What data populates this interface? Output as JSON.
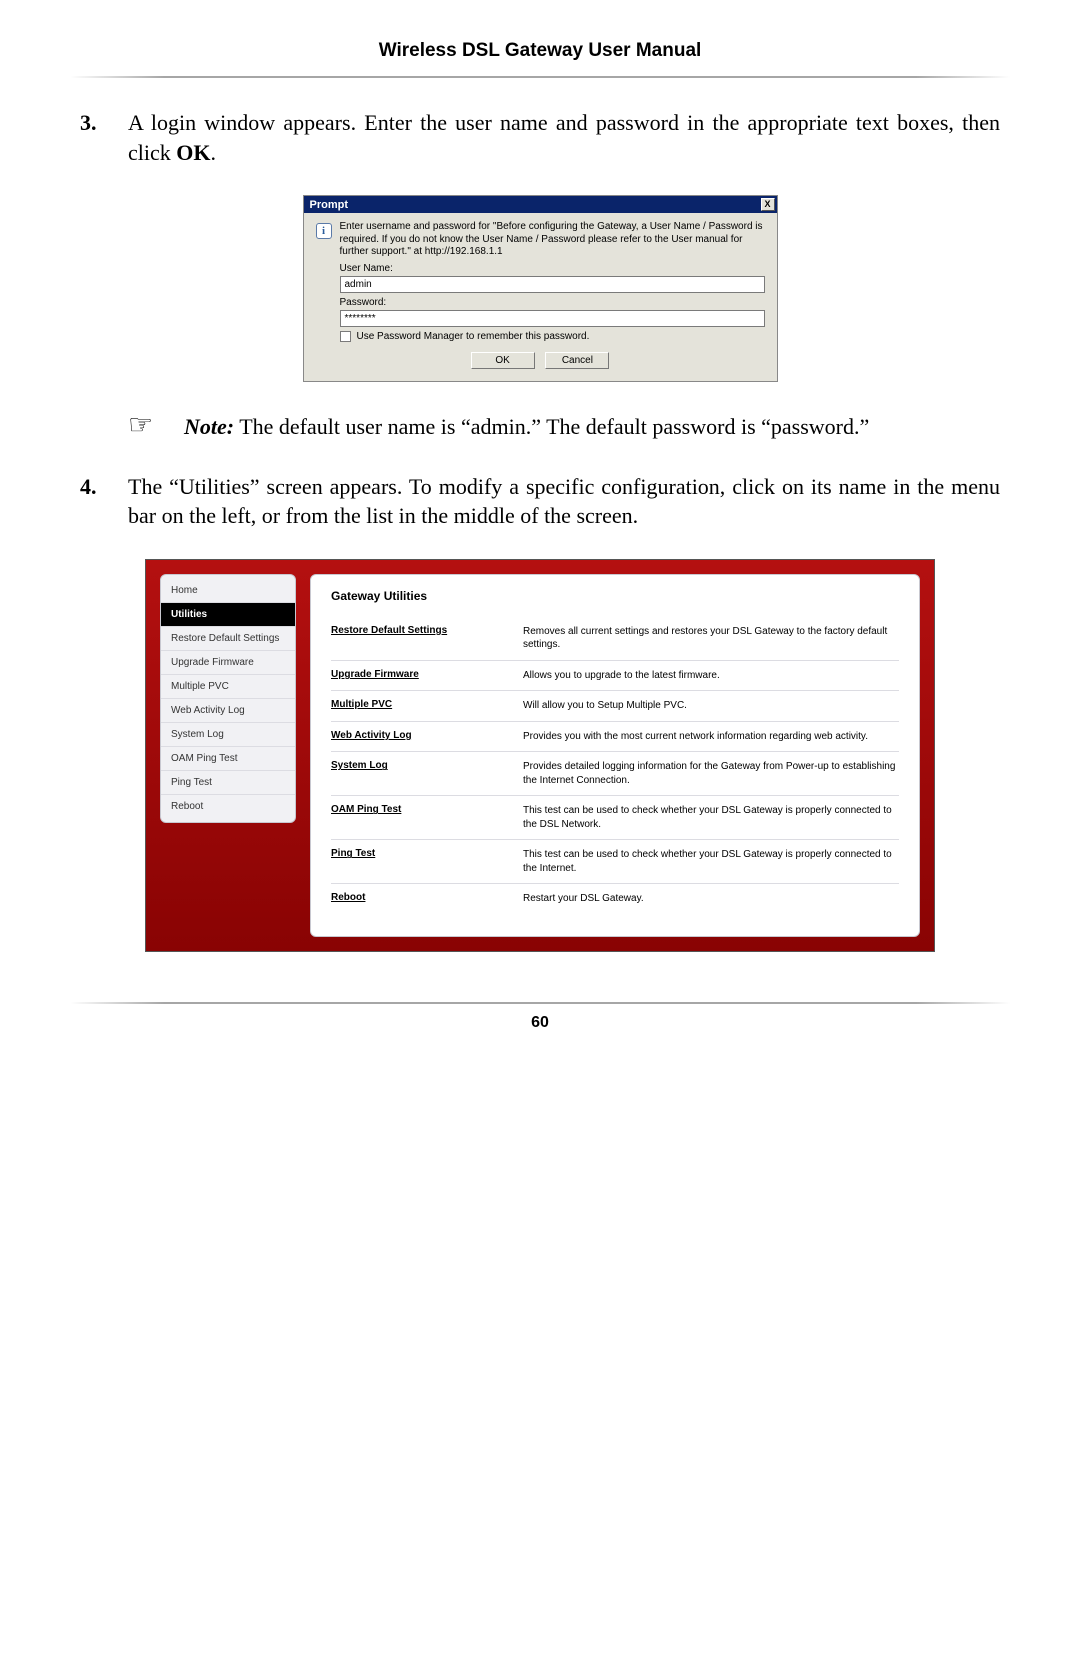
{
  "header": {
    "title": "Wireless DSL Gateway User Manual"
  },
  "pageNumber": "60",
  "step3": {
    "num": "3.",
    "text_a": "A login window appears. Enter the user name and password in the appropriate text boxes, then click ",
    "text_b": "OK",
    "text_c": "."
  },
  "note": {
    "label": "Note:",
    "text": " The default user name is “admin.” The default password is “password.”"
  },
  "step4": {
    "num": "4.",
    "text": "The “Utilities” screen appears. To modify a specific configuration, click on its name in the menu bar on the left, or from the list in the middle of the screen."
  },
  "prompt": {
    "title": "Prompt",
    "close": "X",
    "info_glyph": "i",
    "message": "Enter username and password for \"Before configuring the Gateway, a User Name / Password is required. If you do not know the User Name / Password please refer to the User manual for further support.\" at http://192.168.1.1",
    "userLabel": "User Name:",
    "userValue": "admin",
    "passLabel": "Password:",
    "passValue": "********",
    "checkLabel": "Use Password Manager to remember this password.",
    "ok": "OK",
    "cancel": "Cancel"
  },
  "utilities": {
    "sidebar": [
      {
        "label": "Home",
        "active": false
      },
      {
        "label": "Utilities",
        "active": true
      },
      {
        "label": "Restore Default Settings",
        "active": false
      },
      {
        "label": "Upgrade Firmware",
        "active": false
      },
      {
        "label": "Multiple PVC",
        "active": false
      },
      {
        "label": "Web Activity Log",
        "active": false
      },
      {
        "label": "System Log",
        "active": false
      },
      {
        "label": "OAM Ping Test",
        "active": false
      },
      {
        "label": "Ping Test",
        "active": false
      },
      {
        "label": "Reboot",
        "active": false
      }
    ],
    "heading": "Gateway Utilities",
    "rows": [
      {
        "link": "Restore Default Settings",
        "desc": "Removes all current settings and restores your DSL Gateway to the factory default settings."
      },
      {
        "link": "Upgrade Firmware",
        "desc": "Allows you to upgrade to the latest firmware."
      },
      {
        "link": "Multiple PVC",
        "desc": "Will allow you to Setup Multiple PVC."
      },
      {
        "link": "Web Activity Log",
        "desc": "Provides you with the most current network information regarding web activity."
      },
      {
        "link": "System Log",
        "desc": "Provides detailed logging information for the Gateway from Power-up to establishing the Internet Connection."
      },
      {
        "link": "OAM Ping Test",
        "desc": "This test can be used to check whether your DSL Gateway is properly connected to the DSL Network."
      },
      {
        "link": "Ping Test",
        "desc": "This test can be used to check whether your DSL Gateway is properly connected to the Internet."
      },
      {
        "link": "Reboot",
        "desc": "Restart your DSL Gateway."
      }
    ]
  },
  "note_icon_glyph": "☞"
}
